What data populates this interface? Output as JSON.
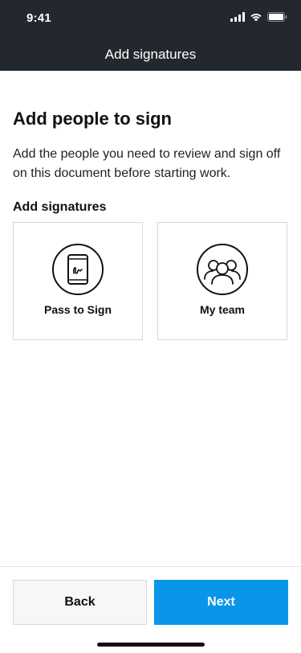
{
  "status_bar": {
    "time": "9:41",
    "icons": [
      "cellular-signal-icon",
      "wifi-icon",
      "battery-icon"
    ]
  },
  "nav": {
    "title": "Add signatures"
  },
  "main": {
    "title": "Add people to sign",
    "description": "Add the people you need to review and sign off on this document before starting work.",
    "section_label": "Add signatures",
    "options": [
      {
        "label": "Pass to Sign",
        "icon": "phone-signature-icon"
      },
      {
        "label": "My team",
        "icon": "team-icon"
      }
    ]
  },
  "footer": {
    "back_label": "Back",
    "next_label": "Next"
  },
  "colors": {
    "header_bg": "#23272e",
    "primary": "#0a96e8",
    "secondary_bg": "#f7f7f7",
    "border": "#d7d7d7"
  }
}
